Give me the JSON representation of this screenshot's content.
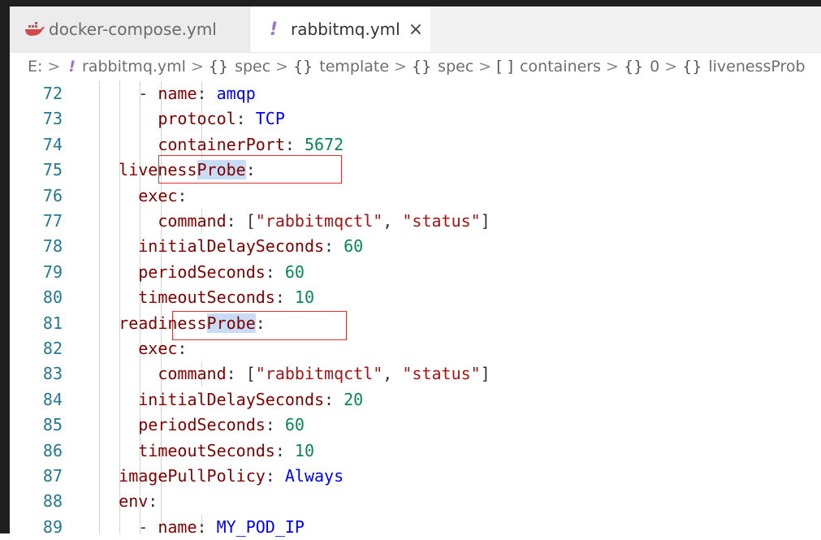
{
  "tabs": [
    {
      "label": "docker-compose.yml",
      "icon": "docker-icon",
      "active": false
    },
    {
      "label": "rabbitmq.yml",
      "icon": "yaml-exclamation-icon",
      "active": true,
      "close": "×"
    }
  ],
  "breadcrumb": {
    "drive": "E:",
    "file": "rabbitmq.yml",
    "items": [
      {
        "symbol": "{}",
        "label": "spec"
      },
      {
        "symbol": "{}",
        "label": "template"
      },
      {
        "symbol": "{}",
        "label": "spec"
      },
      {
        "symbol": "[ ]",
        "label": "containers"
      },
      {
        "symbol": "{}",
        "label": "0"
      },
      {
        "symbol": "{}",
        "label": "livenessProb"
      }
    ]
  },
  "lines": [
    {
      "n": "72",
      "t": [
        [
          "      - ",
          ""
        ],
        [
          "name",
          "key"
        ],
        [
          ": ",
          ""
        ],
        [
          "amqp",
          "val"
        ]
      ]
    },
    {
      "n": "73",
      "t": [
        [
          "        ",
          ""
        ],
        [
          "protocol",
          "key"
        ],
        [
          ": ",
          ""
        ],
        [
          "TCP",
          "val"
        ]
      ]
    },
    {
      "n": "74",
      "t": [
        [
          "        ",
          ""
        ],
        [
          "containerPort",
          "key"
        ],
        [
          ": ",
          ""
        ],
        [
          "5672",
          "num"
        ]
      ]
    },
    {
      "n": "75",
      "t": [
        [
          "    ",
          ""
        ],
        [
          "liveness",
          "key"
        ],
        [
          "Probe",
          "key hl"
        ],
        [
          ":",
          ""
        ]
      ]
    },
    {
      "n": "76",
      "t": [
        [
          "      ",
          ""
        ],
        [
          "exec",
          "key"
        ],
        [
          ":",
          ""
        ]
      ]
    },
    {
      "n": "77",
      "t": [
        [
          "        ",
          ""
        ],
        [
          "command",
          "key"
        ],
        [
          ": [",
          ""
        ],
        [
          "\"rabbitmqctl\"",
          "str"
        ],
        [
          ", ",
          ""
        ],
        [
          "\"status\"",
          "str"
        ],
        [
          "]",
          ""
        ]
      ]
    },
    {
      "n": "78",
      "t": [
        [
          "      ",
          ""
        ],
        [
          "initialDelaySeconds",
          "key"
        ],
        [
          ": ",
          ""
        ],
        [
          "60",
          "num"
        ]
      ]
    },
    {
      "n": "79",
      "t": [
        [
          "      ",
          ""
        ],
        [
          "periodSeconds",
          "key"
        ],
        [
          ": ",
          ""
        ],
        [
          "60",
          "num"
        ]
      ]
    },
    {
      "n": "80",
      "t": [
        [
          "      ",
          ""
        ],
        [
          "timeoutSeconds",
          "key"
        ],
        [
          ": ",
          ""
        ],
        [
          "10",
          "num"
        ]
      ]
    },
    {
      "n": "81",
      "t": [
        [
          "    ",
          ""
        ],
        [
          "readiness",
          "key"
        ],
        [
          "Probe",
          "key hl"
        ],
        [
          ":",
          ""
        ]
      ]
    },
    {
      "n": "82",
      "t": [
        [
          "      ",
          ""
        ],
        [
          "exec",
          "key"
        ],
        [
          ":",
          ""
        ]
      ]
    },
    {
      "n": "83",
      "t": [
        [
          "        ",
          ""
        ],
        [
          "command",
          "key"
        ],
        [
          ": [",
          ""
        ],
        [
          "\"rabbitmqctl\"",
          "str"
        ],
        [
          ", ",
          ""
        ],
        [
          "\"status\"",
          "str"
        ],
        [
          "]",
          ""
        ]
      ]
    },
    {
      "n": "84",
      "t": [
        [
          "      ",
          ""
        ],
        [
          "initialDelaySeconds",
          "key"
        ],
        [
          ": ",
          ""
        ],
        [
          "20",
          "num"
        ]
      ]
    },
    {
      "n": "85",
      "t": [
        [
          "      ",
          ""
        ],
        [
          "periodSeconds",
          "key"
        ],
        [
          ": ",
          ""
        ],
        [
          "60",
          "num"
        ]
      ]
    },
    {
      "n": "86",
      "t": [
        [
          "      ",
          ""
        ],
        [
          "timeoutSeconds",
          "key"
        ],
        [
          ": ",
          ""
        ],
        [
          "10",
          "num"
        ]
      ]
    },
    {
      "n": "87",
      "t": [
        [
          "    ",
          ""
        ],
        [
          "imagePullPolicy",
          "key"
        ],
        [
          ": ",
          ""
        ],
        [
          "Always",
          "val"
        ]
      ]
    },
    {
      "n": "88",
      "t": [
        [
          "    ",
          ""
        ],
        [
          "env",
          "key"
        ],
        [
          ":",
          ""
        ]
      ]
    },
    {
      "n": "89",
      "t": [
        [
          "      - ",
          ""
        ],
        [
          "name",
          "key"
        ],
        [
          ": ",
          ""
        ],
        [
          "MY_POD_IP",
          "val"
        ]
      ]
    }
  ],
  "colors": {
    "key": "#800000",
    "value": "#0000ff",
    "number": "#098658",
    "string": "#a31515",
    "line_number": "#237893",
    "annotation_box": "#e03030"
  }
}
